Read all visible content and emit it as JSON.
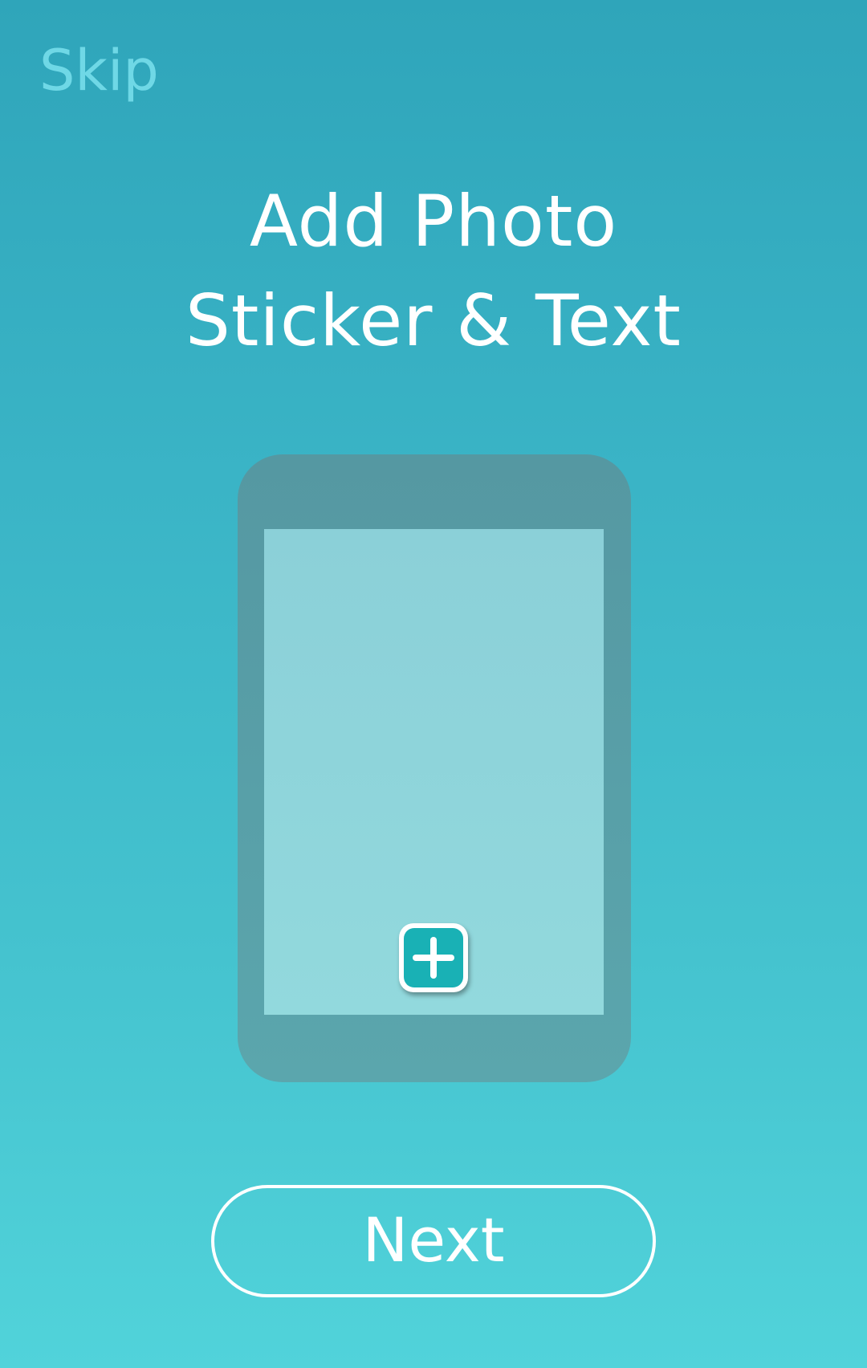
{
  "header": {
    "skip_label": "Skip"
  },
  "title": {
    "line1": "Add Photo",
    "line2": "Sticker & Text"
  },
  "illustration": {
    "add_icon": "plus-icon"
  },
  "footer": {
    "next_label": "Next"
  },
  "colors": {
    "background_top": "#2fa5ba",
    "background_bottom": "#51d3da",
    "skip_text": "#6fd8e6",
    "phone_body": "#5598a2",
    "phone_screen": "#8bd0d8",
    "add_button": "#19b1b5",
    "white": "#ffffff"
  }
}
